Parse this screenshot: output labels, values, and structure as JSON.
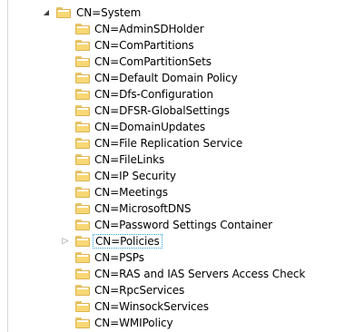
{
  "tree": {
    "root": {
      "label": "CN=System",
      "icon": "folder-icon",
      "expanded": true,
      "toggle_icon": "chevron-expanded-icon"
    },
    "children": [
      {
        "label": "CN=AdminSDHolder"
      },
      {
        "label": "CN=ComPartitions"
      },
      {
        "label": "CN=ComPartitionSets"
      },
      {
        "label": "CN=Default Domain Policy"
      },
      {
        "label": "CN=Dfs-Configuration"
      },
      {
        "label": "CN=DFSR-GlobalSettings"
      },
      {
        "label": "CN=DomainUpdates"
      },
      {
        "label": "CN=File Replication Service"
      },
      {
        "label": "CN=FileLinks"
      },
      {
        "label": "CN=IP Security"
      },
      {
        "label": "CN=Meetings"
      },
      {
        "label": "CN=MicrosoftDNS"
      },
      {
        "label": "CN=Password Settings Container"
      },
      {
        "label": "CN=Policies",
        "selected": true,
        "has_children": true,
        "toggle_icon": "chevron-collapsed-icon"
      },
      {
        "label": "CN=PSPs"
      },
      {
        "label": "CN=RAS and IAS Servers Access Check"
      },
      {
        "label": "CN=RpcServices"
      },
      {
        "label": "CN=WinsockServices"
      },
      {
        "label": "CN=WMIPolicy"
      }
    ]
  },
  "colors": {
    "folder_fill": "#f8d775",
    "folder_border": "#dcb452",
    "selection_border": "#26a0da"
  }
}
